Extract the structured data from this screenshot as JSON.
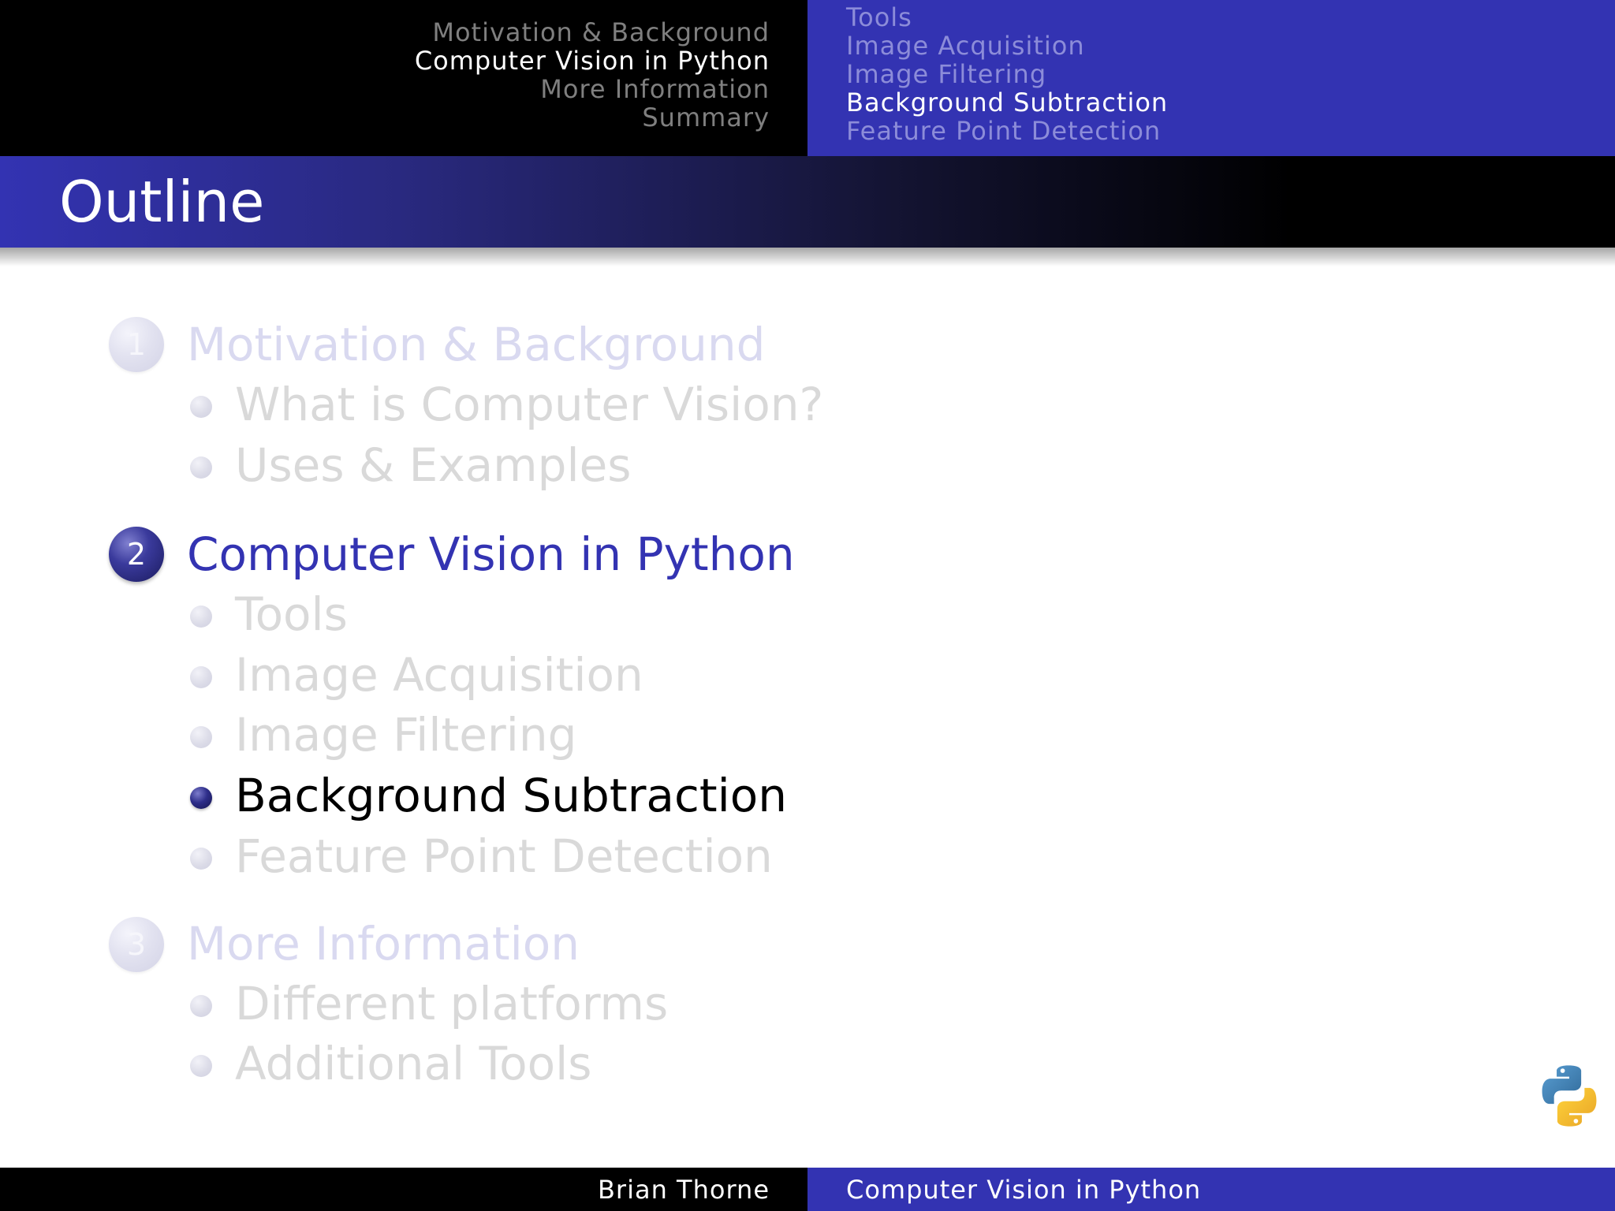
{
  "header": {
    "sections": [
      "Motivation & Background",
      "Computer Vision in Python",
      "More Information",
      "Summary"
    ],
    "subsections": [
      "Tools",
      "Image Acquisition",
      "Image Filtering",
      "Background Subtraction",
      "Feature Point Detection"
    ]
  },
  "frame": {
    "title": "Outline"
  },
  "outline": {
    "sections": [
      {
        "number": "1",
        "label": "Motivation & Background",
        "items": [
          "What is Computer Vision?",
          "Uses & Examples"
        ]
      },
      {
        "number": "2",
        "label": "Computer Vision in Python",
        "items": [
          "Tools",
          "Image Acquisition",
          "Image Filtering",
          "Background Subtraction",
          "Feature Point Detection"
        ]
      },
      {
        "number": "3",
        "label": "More Information",
        "items": [
          "Different platforms",
          "Additional Tools"
        ]
      }
    ]
  },
  "footer": {
    "author": "Brian Thorne",
    "talk_title": "Computer Vision in Python"
  },
  "logo": {
    "icon": "python-logo-icon",
    "colors": {
      "blue": "#3c74a6",
      "yellow": "#f7c544"
    }
  },
  "colors": {
    "accent": "#3333b2",
    "current_bullet": "#1b1b5e",
    "dim_text": "#d9d9d9"
  }
}
